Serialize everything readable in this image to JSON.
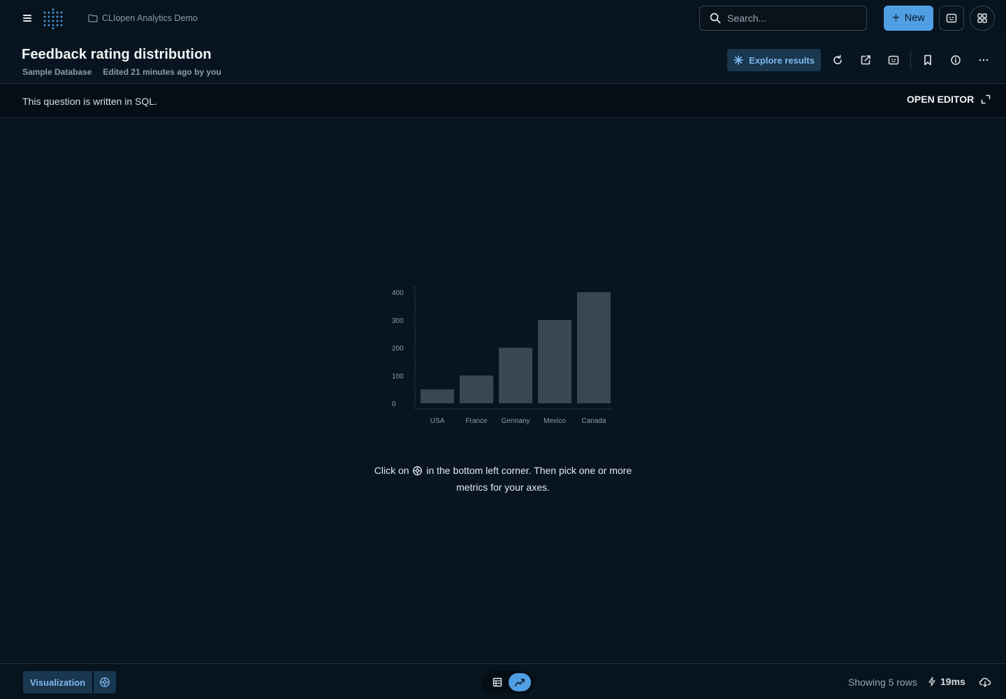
{
  "nav": {
    "breadcrumb": "CLIopen Analytics Demo",
    "search_placeholder": "Search...",
    "new_label": "New"
  },
  "header": {
    "title": "Feedback rating distribution",
    "database": "Sample Database",
    "edited": "Edited 21 minutes ago by you",
    "explore_label": "Explore results"
  },
  "sql_bar": {
    "message": "This question is written in SQL.",
    "open_editor_label": "OPEN EDITOR"
  },
  "empty_state": {
    "hint_before": "Click on",
    "hint_after": "in the bottom left corner. Then pick one or more metrics for your axes."
  },
  "chart_data": {
    "type": "bar",
    "categories": [
      "USA",
      "France",
      "Germany",
      "Mexico",
      "Canada"
    ],
    "values": [
      50,
      100,
      200,
      300,
      400
    ],
    "yticks": [
      "400",
      "300",
      "200",
      "100",
      "0"
    ],
    "ylim": [
      0,
      400
    ],
    "bar_color": "#3a4753"
  },
  "footer": {
    "visualization_label": "Visualization",
    "rows_label": "Showing 5 rows",
    "timing_label": "19ms"
  },
  "colors": {
    "accent": "#509ee3",
    "background": "#081520"
  }
}
